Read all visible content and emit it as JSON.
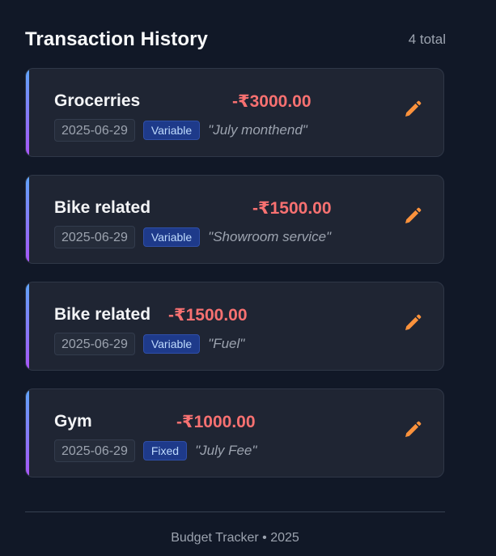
{
  "header": {
    "title": "Transaction History",
    "total": "4 total"
  },
  "transactions": [
    {
      "category": "Grocerries",
      "amount": "-₹3000.00",
      "date": "2025-06-29",
      "type": "Variable",
      "note": "\"July monthend\""
    },
    {
      "category": "Bike related",
      "amount": "-₹1500.00",
      "date": "2025-06-29",
      "type": "Variable",
      "note": "\"Showroom service\""
    },
    {
      "category": "Bike related",
      "amount": "-₹1500.00",
      "date": "2025-06-29",
      "type": "Variable",
      "note": "\"Fuel\""
    },
    {
      "category": "Gym",
      "amount": "-₹1000.00",
      "date": "2025-06-29",
      "type": "Fixed",
      "note": "\"July Fee\""
    }
  ],
  "footer": {
    "text": "Budget Tracker • 2025"
  },
  "colors": {
    "background": "#111827",
    "card": "#1f2533",
    "expense": "#f87171",
    "badge": "#1e3a8a",
    "edit_icon": "#fb923c",
    "accent_top": "#60a5fa",
    "accent_bottom": "#a855f7"
  },
  "icons": {
    "edit": "pencil-icon"
  }
}
